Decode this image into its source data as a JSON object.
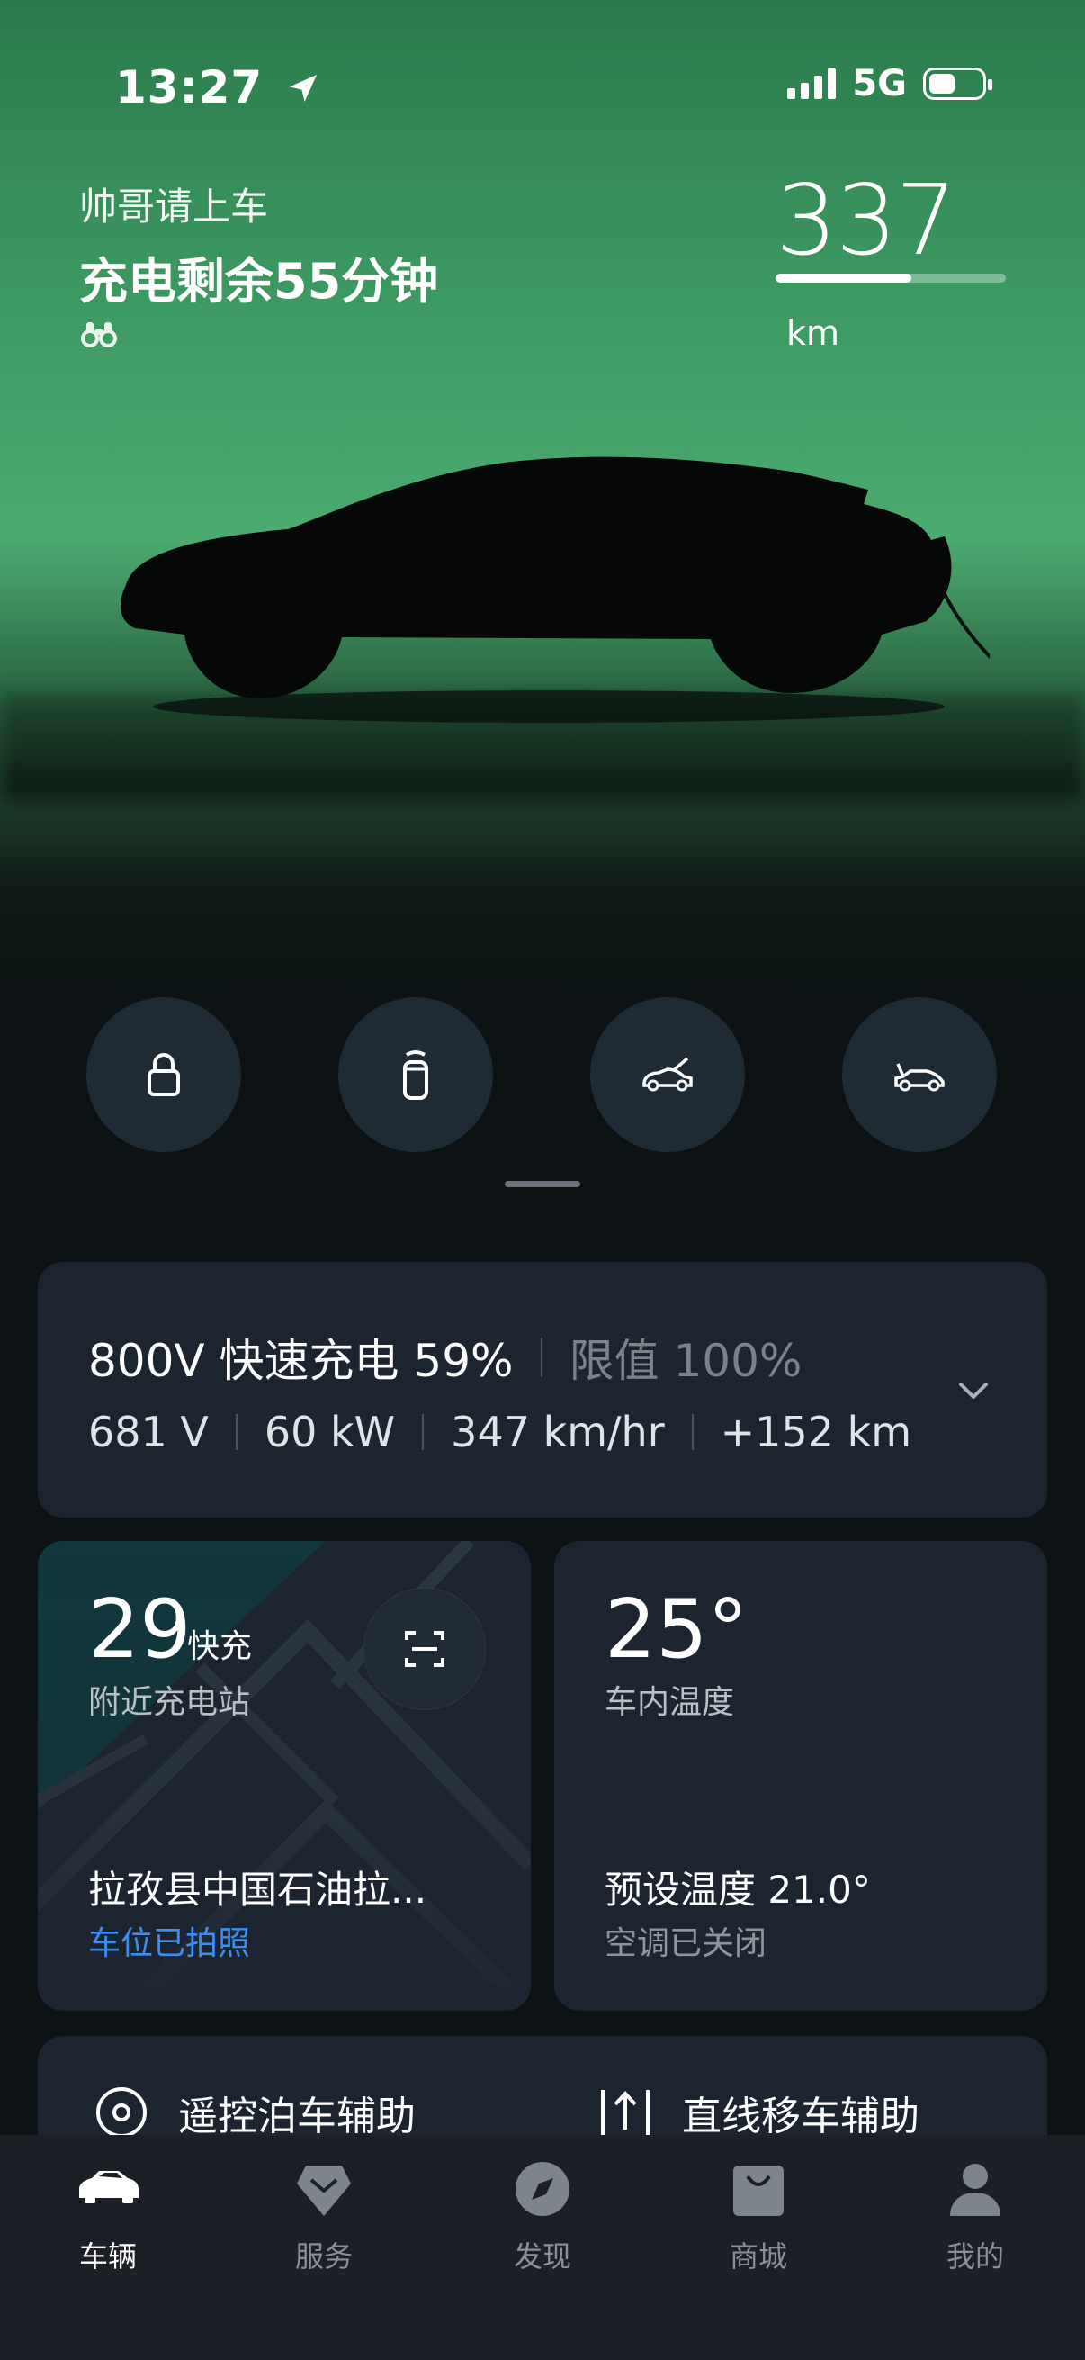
{
  "status_bar": {
    "time": "13:27",
    "network": "5G"
  },
  "header": {
    "greeting": "帅哥请上车",
    "charge_remaining": "充电剩余55分钟",
    "binocular_icon": "🔭"
  },
  "range": {
    "value": "337",
    "unit": "km",
    "fill_fraction": 0.59
  },
  "quick_controls": [
    {
      "name": "lock",
      "icon": "lock-icon"
    },
    {
      "name": "key",
      "icon": "key-fob-icon"
    },
    {
      "name": "frunk",
      "icon": "frunk-open-icon"
    },
    {
      "name": "trunk",
      "icon": "trunk-open-icon"
    }
  ],
  "charging": {
    "title": "800V 快速充电 59%",
    "limit": "限值 100%",
    "voltage": "681 V",
    "power": "60 kW",
    "rate": "347 km/hr",
    "added": "+152 km"
  },
  "station": {
    "count": "29",
    "count_suffix": "快充",
    "label": "附近充电站",
    "name": "拉孜县中国石油拉...",
    "photo_status": "车位已拍照"
  },
  "climate": {
    "temperature": "25°",
    "label": "车内温度",
    "preset": "预设温度 21.0°",
    "ac_status": "空调已关闭"
  },
  "assist": {
    "remote_parking": "遥控泊车辅助",
    "straight_move": "直线移车辅助"
  },
  "tabs": [
    {
      "label": "车辆",
      "active": true
    },
    {
      "label": "服务",
      "active": false
    },
    {
      "label": "发现",
      "active": false
    },
    {
      "label": "商城",
      "active": false
    },
    {
      "label": "我的",
      "active": false
    }
  ],
  "colors": {
    "accent_blue": "#3e8df2",
    "hero_green": "#4cab6f",
    "card_bg": "#1c2430"
  }
}
